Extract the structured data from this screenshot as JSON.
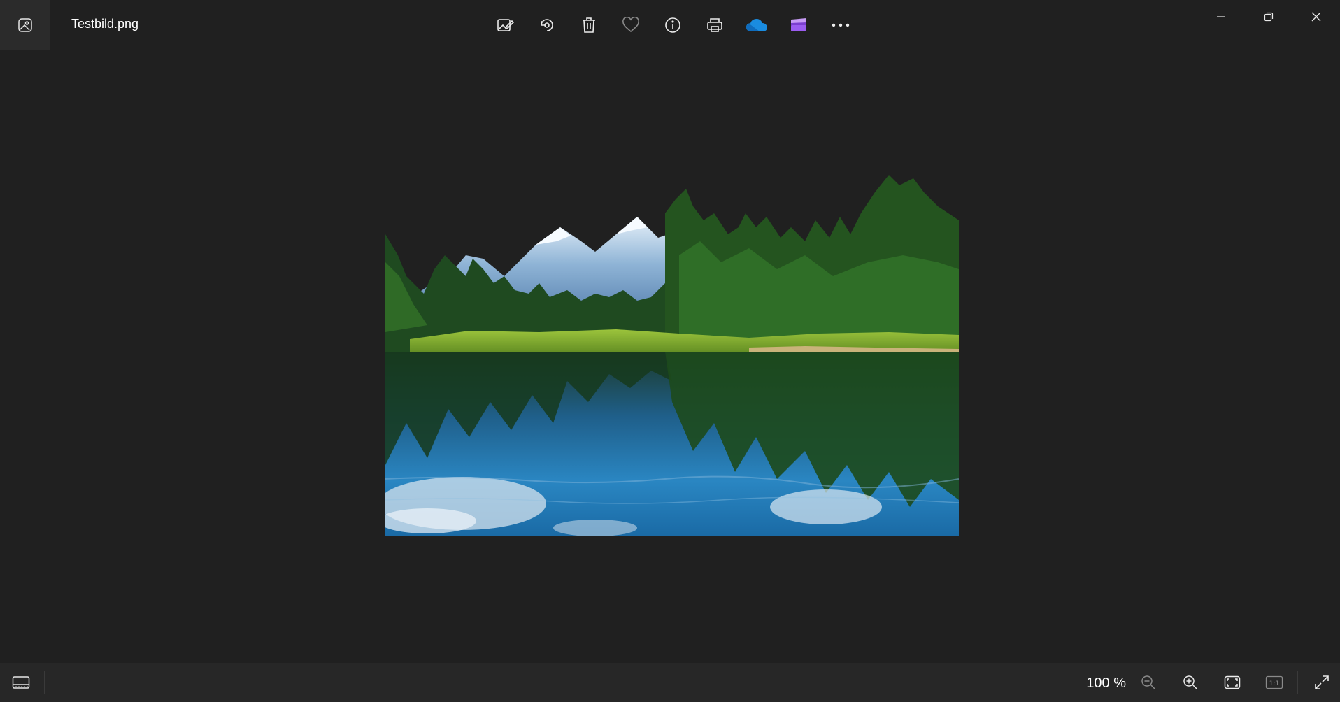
{
  "window": {
    "file_name": "Testbild.png",
    "app_icon": "photos-app-icon",
    "controls": {
      "minimize": "minimize-icon",
      "restore": "restore-icon",
      "close": "close-icon"
    }
  },
  "toolbar": {
    "items": [
      {
        "name": "edit-image",
        "icon": "edit-image-icon"
      },
      {
        "name": "rotate",
        "icon": "rotate-icon"
      },
      {
        "name": "delete",
        "icon": "trash-icon"
      },
      {
        "name": "favorite",
        "icon": "heart-icon"
      },
      {
        "name": "file-info",
        "icon": "info-icon"
      },
      {
        "name": "print",
        "icon": "printer-icon"
      },
      {
        "name": "onedrive",
        "icon": "onedrive-cloud-icon"
      },
      {
        "name": "clipchamp",
        "icon": "clipchamp-icon"
      },
      {
        "name": "more",
        "icon": "more-dots-icon"
      }
    ]
  },
  "image": {
    "subject": "mountain lake with pine forest reflection"
  },
  "bottombar": {
    "zoom_label": "100 %",
    "actual_size_label": "1:1"
  },
  "colors": {
    "background": "#202020",
    "bar": "#272727",
    "onedrive": "#1a8ce0",
    "clipchamp": "#8a4bd6"
  }
}
